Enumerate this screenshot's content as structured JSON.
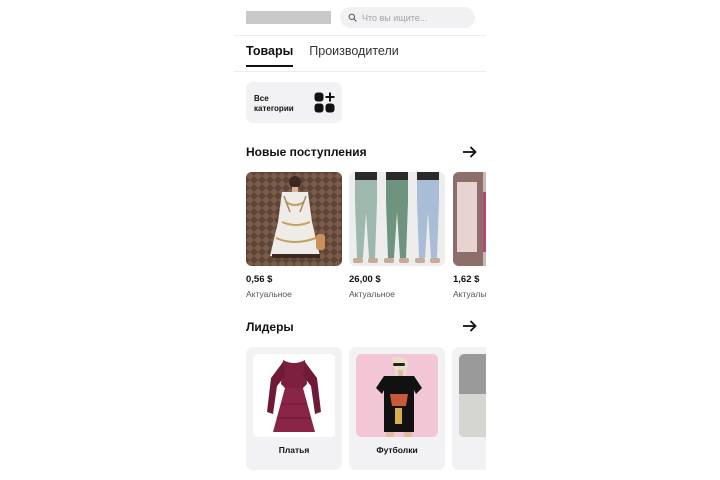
{
  "header": {
    "search_placeholder": "Что вы ищите..."
  },
  "tabs": [
    {
      "label": "Товары",
      "active": true
    },
    {
      "label": "Производители",
      "active": false
    }
  ],
  "all_categories": {
    "line1": "Все",
    "line2": "категории",
    "icon": "grid-plus-icon"
  },
  "new_arrivals": {
    "title": "Новые поступления",
    "arrow_icon": "arrow-right-icon",
    "items": [
      {
        "price": "0,56 $",
        "status": "Актуальное",
        "image": "white-chain-print-dress"
      },
      {
        "price": "26,00 $",
        "status": "Актуальное",
        "image": "pastel-leggings"
      },
      {
        "price": "1,62 $",
        "status": "Актуальное",
        "image": "product-photo-partial"
      }
    ]
  },
  "leaders": {
    "title": "Лидеры",
    "arrow_icon": "arrow-right-icon",
    "items": [
      {
        "name": "Платья",
        "image": "burgundy-dress"
      },
      {
        "name": "Футболки",
        "image": "black-graphic-tshirt"
      },
      {
        "name": "",
        "image": "category-photo-partial"
      }
    ]
  },
  "colors": {
    "accent": "#111111",
    "card_bg": "#f2f2f4",
    "search_bg": "#f1f1f3"
  }
}
